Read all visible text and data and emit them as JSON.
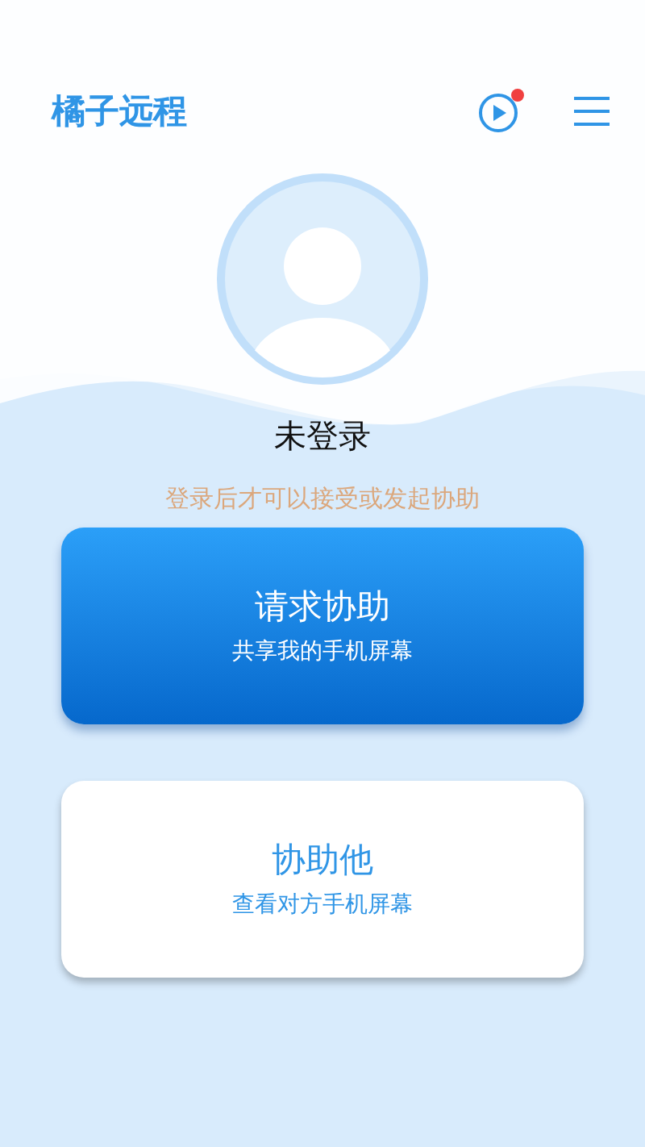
{
  "header": {
    "title": "橘子远程",
    "play_notification": true
  },
  "profile": {
    "name": "未登录",
    "hint": "登录后才可以接受或发起协助"
  },
  "cards": [
    {
      "kind": "primary",
      "title": "请求协助",
      "subtitle": "共享我的手机屏幕"
    },
    {
      "kind": "secondary",
      "title": "协助他",
      "subtitle": "查看对方手机屏幕"
    }
  ]
}
